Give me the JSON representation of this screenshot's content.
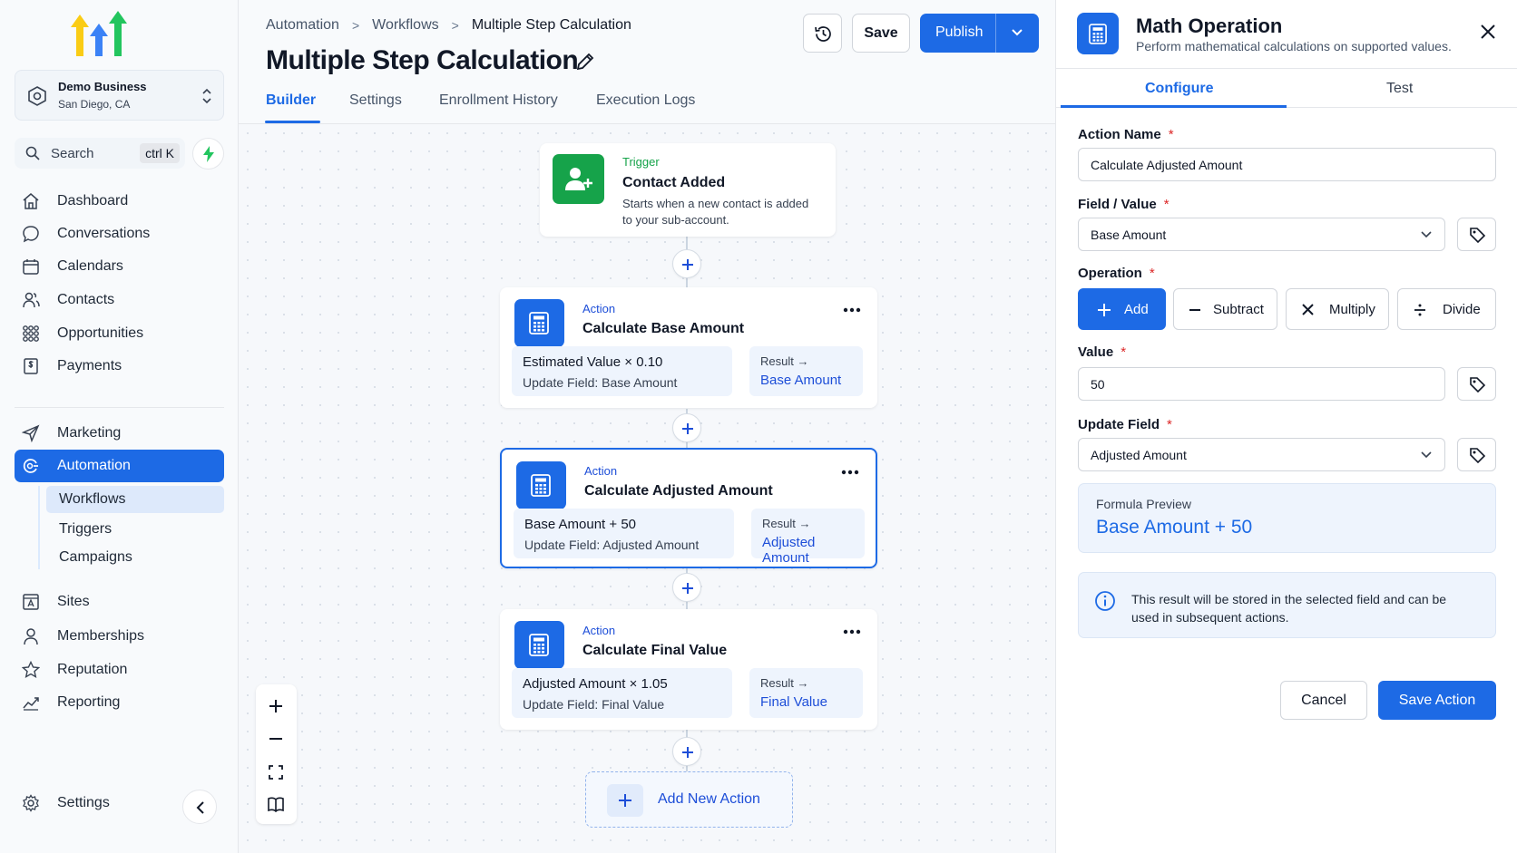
{
  "sidebar": {
    "business": {
      "name": "Demo Business",
      "location": "San Diego, CA"
    },
    "search": {
      "label": "Search",
      "shortcut": "ctrl K"
    },
    "items": [
      {
        "label": "Dashboard",
        "icon": "home-icon"
      },
      {
        "label": "Conversations",
        "icon": "chat-icon"
      },
      {
        "label": "Calendars",
        "icon": "calendar-icon"
      },
      {
        "label": "Contacts",
        "icon": "contacts-icon"
      },
      {
        "label": "Opportunities",
        "icon": "opportunities-icon"
      },
      {
        "label": "Payments",
        "icon": "payments-icon"
      },
      {
        "label": "Marketing",
        "icon": "send-icon"
      },
      {
        "label": "Automation",
        "icon": "automation-icon",
        "active": true
      },
      {
        "label": "Sites",
        "icon": "sites-icon"
      },
      {
        "label": "Memberships",
        "icon": "user-icon"
      },
      {
        "label": "Reputation",
        "icon": "star-icon"
      },
      {
        "label": "Reporting",
        "icon": "chart-icon"
      }
    ],
    "subitems": [
      {
        "label": "Workflows",
        "active": true
      },
      {
        "label": "Triggers"
      },
      {
        "label": "Campaigns"
      }
    ],
    "settings": "Settings"
  },
  "header": {
    "breadcrumb": [
      "Automation",
      "Workflows",
      "Multiple Step Calculation"
    ],
    "title": "Multiple Step Calculation",
    "tabs": [
      "Builder",
      "Settings",
      "Enrollment History",
      "Execution Logs"
    ],
    "active_tab": "Builder",
    "save_label": "Save",
    "publish_label": "Publish"
  },
  "workflow": {
    "trigger": {
      "kind": "Trigger",
      "title": "Contact Added",
      "description": "Starts when a new contact is added to your sub-account."
    },
    "actions": [
      {
        "kind": "Action",
        "title": "Calculate Base Amount",
        "formula": "Estimated Value × 0.10",
        "update": "Update Field: Base Amount",
        "result_label": "Result →",
        "result": "Base Amount"
      },
      {
        "kind": "Action",
        "title": "Calculate Adjusted Amount",
        "formula": "Base Amount + 50",
        "update": "Update Field: Adjusted Amount",
        "result_label": "Result →",
        "result": "Adjusted Amount",
        "selected": true
      },
      {
        "kind": "Action",
        "title": "Calculate Final Value",
        "formula": "Adjusted Amount × 1.05",
        "update": "Update Field: Final Value",
        "result_label": "Result →",
        "result": "Final Value"
      }
    ],
    "add_new_label": "Add New Action"
  },
  "panel": {
    "title": "Math Operation",
    "subtitle": "Perform mathematical calculations on supported values.",
    "tabs": [
      "Configure",
      "Test"
    ],
    "active_tab": "Configure",
    "action_name": {
      "label": "Action Name",
      "value": "Calculate Adjusted Amount"
    },
    "field_value": {
      "label": "Field / Value",
      "value": "Base Amount"
    },
    "operation": {
      "label": "Operation",
      "options": [
        "Add",
        "Subtract",
        "Multiply",
        "Divide"
      ],
      "selected": "Add"
    },
    "value": {
      "label": "Value",
      "value": "50"
    },
    "update_field": {
      "label": "Update Field",
      "value": "Adjusted Amount"
    },
    "preview": {
      "label": "Formula Preview",
      "value": "Base Amount + 50"
    },
    "info": "This result will be stored in the selected field and can be used in subsequent actions.",
    "cancel_label": "Cancel",
    "save_label": "Save Action"
  },
  "colors": {
    "accent": "#1d6ae5",
    "trigger": "#16a34a"
  }
}
